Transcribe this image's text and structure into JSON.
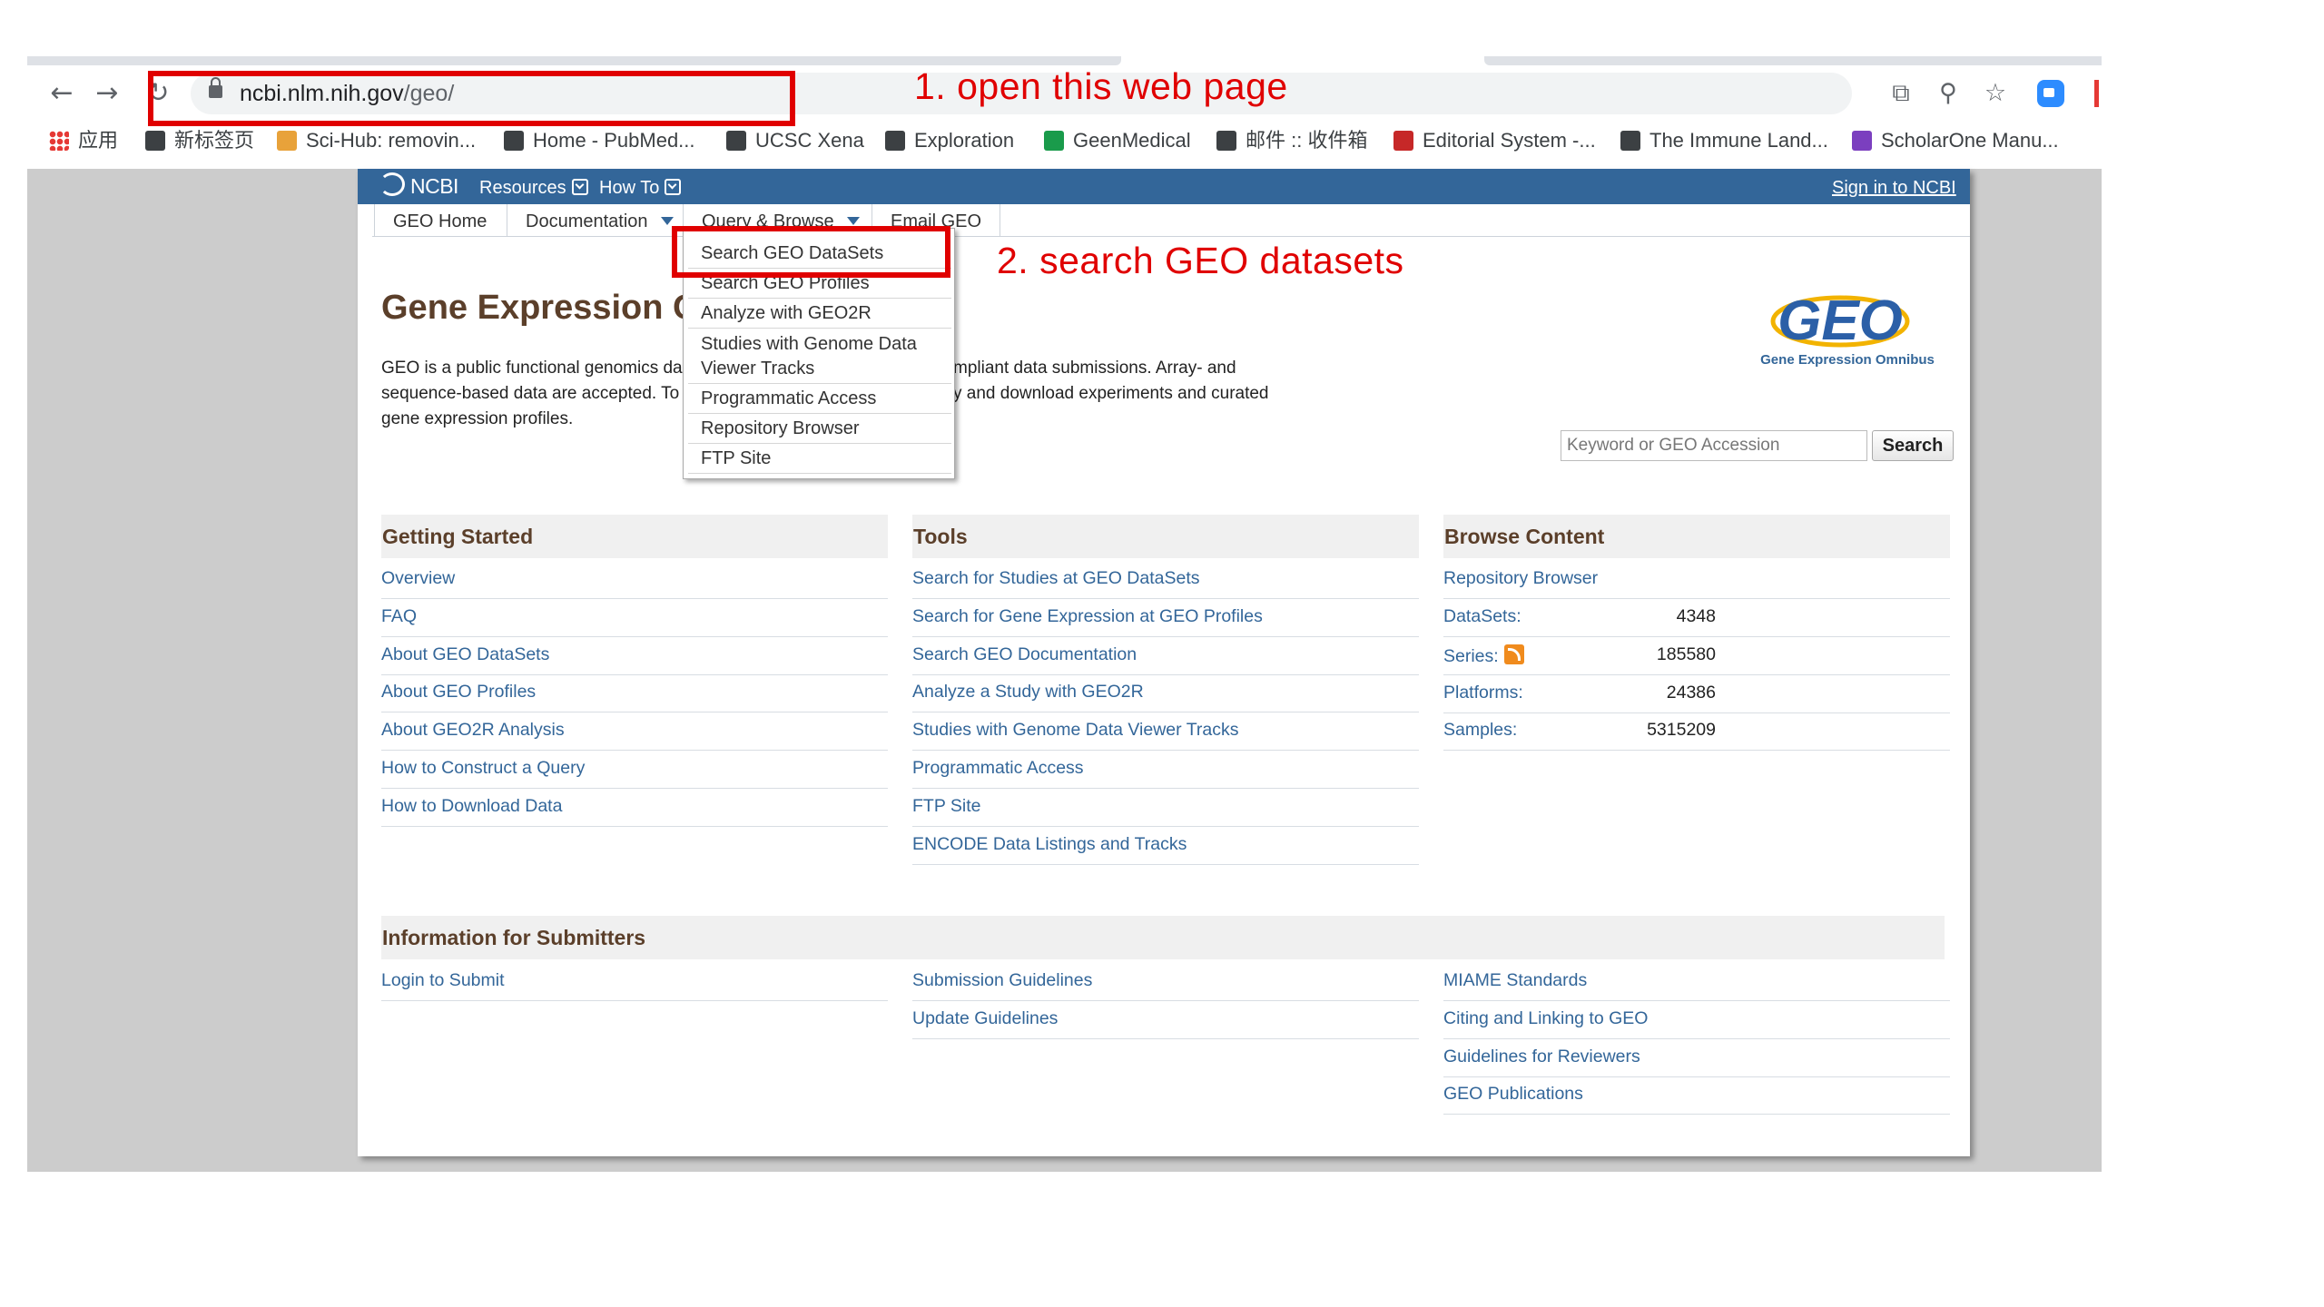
{
  "browser": {
    "url_host": "ncbi.nlm.nih.gov",
    "url_path": "/geo/",
    "bookmarks": [
      {
        "label": "应用",
        "icon": "apps-grid-icon",
        "color": "#e53935"
      },
      {
        "label": "新标签页",
        "icon": "globe-icon",
        "color": "#3c4043"
      },
      {
        "label": "Sci-Hub: removin...",
        "icon": "scihub-icon",
        "color": "#e8a23a"
      },
      {
        "label": "Home - PubMed...",
        "icon": "bookmark-tag-icon",
        "color": "#3c4043"
      },
      {
        "label": "UCSC Xena",
        "icon": "xena-icon",
        "color": "#3c4043"
      },
      {
        "label": "Exploration",
        "icon": "bookmark-tag-icon",
        "color": "#3c4043"
      },
      {
        "label": "GeenMedical",
        "icon": "geenmedical-icon",
        "color": "#1a9b4b"
      },
      {
        "label": "邮件 :: 收件箱",
        "icon": "mail-icon",
        "color": "#3c4043"
      },
      {
        "label": "Editorial System -...",
        "icon": "sn-icon",
        "color": "#c62828"
      },
      {
        "label": "The Immune Land...",
        "icon": "bookmark-tag-icon",
        "color": "#3c4043"
      },
      {
        "label": "ScholarOne Manu...",
        "icon": "scholarone-icon",
        "color": "#7b3fbf"
      }
    ]
  },
  "ncbi": {
    "logo": "NCBI",
    "resources": "Resources",
    "howto": "How To",
    "signin": "Sign in to NCBI"
  },
  "tabs": {
    "geo_home": "GEO Home",
    "documentation": "Documentation",
    "query_browse": "Query & Browse",
    "email": "Email GEO"
  },
  "dropdown": [
    "Search GEO DataSets",
    "Search GEO Profiles",
    "Analyze with GEO2R",
    "Studies with Genome Data Viewer Tracks",
    "Programmatic Access",
    "Repository Browser",
    "FTP Site"
  ],
  "main": {
    "title": "Gene Expression Omnibus",
    "intro_left": [
      "GEO is a public functional genomics da",
      "sequence-based data are accepted. To",
      "gene expression profiles."
    ],
    "intro_right": [
      "mpliant data submissions. Array- and",
      "y and download experiments and curated"
    ],
    "logo_text": "GEO",
    "logo_sub": "Gene Expression Omnibus",
    "search_placeholder": "Keyword or GEO Accession",
    "search_button": "Search"
  },
  "getting_started": {
    "heading": "Getting Started",
    "links": [
      "Overview",
      "FAQ",
      "About GEO DataSets",
      "About GEO Profiles",
      "About GEO2R Analysis",
      "How to Construct a Query",
      "How to Download Data"
    ]
  },
  "tools": {
    "heading": "Tools",
    "links": [
      "Search for Studies at GEO DataSets",
      "Search for Gene Expression at GEO Profiles",
      "Search GEO Documentation",
      "Analyze a Study with GEO2R",
      "Studies with Genome Data Viewer Tracks",
      "Programmatic Access",
      "FTP Site",
      "ENCODE Data Listings and Tracks"
    ]
  },
  "browse": {
    "heading": "Browse Content",
    "repository": "Repository Browser",
    "rows": [
      {
        "label": "DataSets:",
        "value": "4348"
      },
      {
        "label": "Series:",
        "value": "185580"
      },
      {
        "label": "Platforms:",
        "value": "24386"
      },
      {
        "label": "Samples:",
        "value": "5315209"
      }
    ]
  },
  "submitters": {
    "heading": "Information for Submitters",
    "col1": [
      "Login to Submit"
    ],
    "col2": [
      "Submission Guidelines",
      "Update Guidelines"
    ],
    "col3": [
      "MIAME Standards",
      "Citing and Linking to GEO",
      "Guidelines for Reviewers",
      "GEO Publications"
    ]
  },
  "annotations": {
    "step1": "1. open this web page",
    "step2": "2. search GEO datasets",
    "color": "#e00000"
  }
}
